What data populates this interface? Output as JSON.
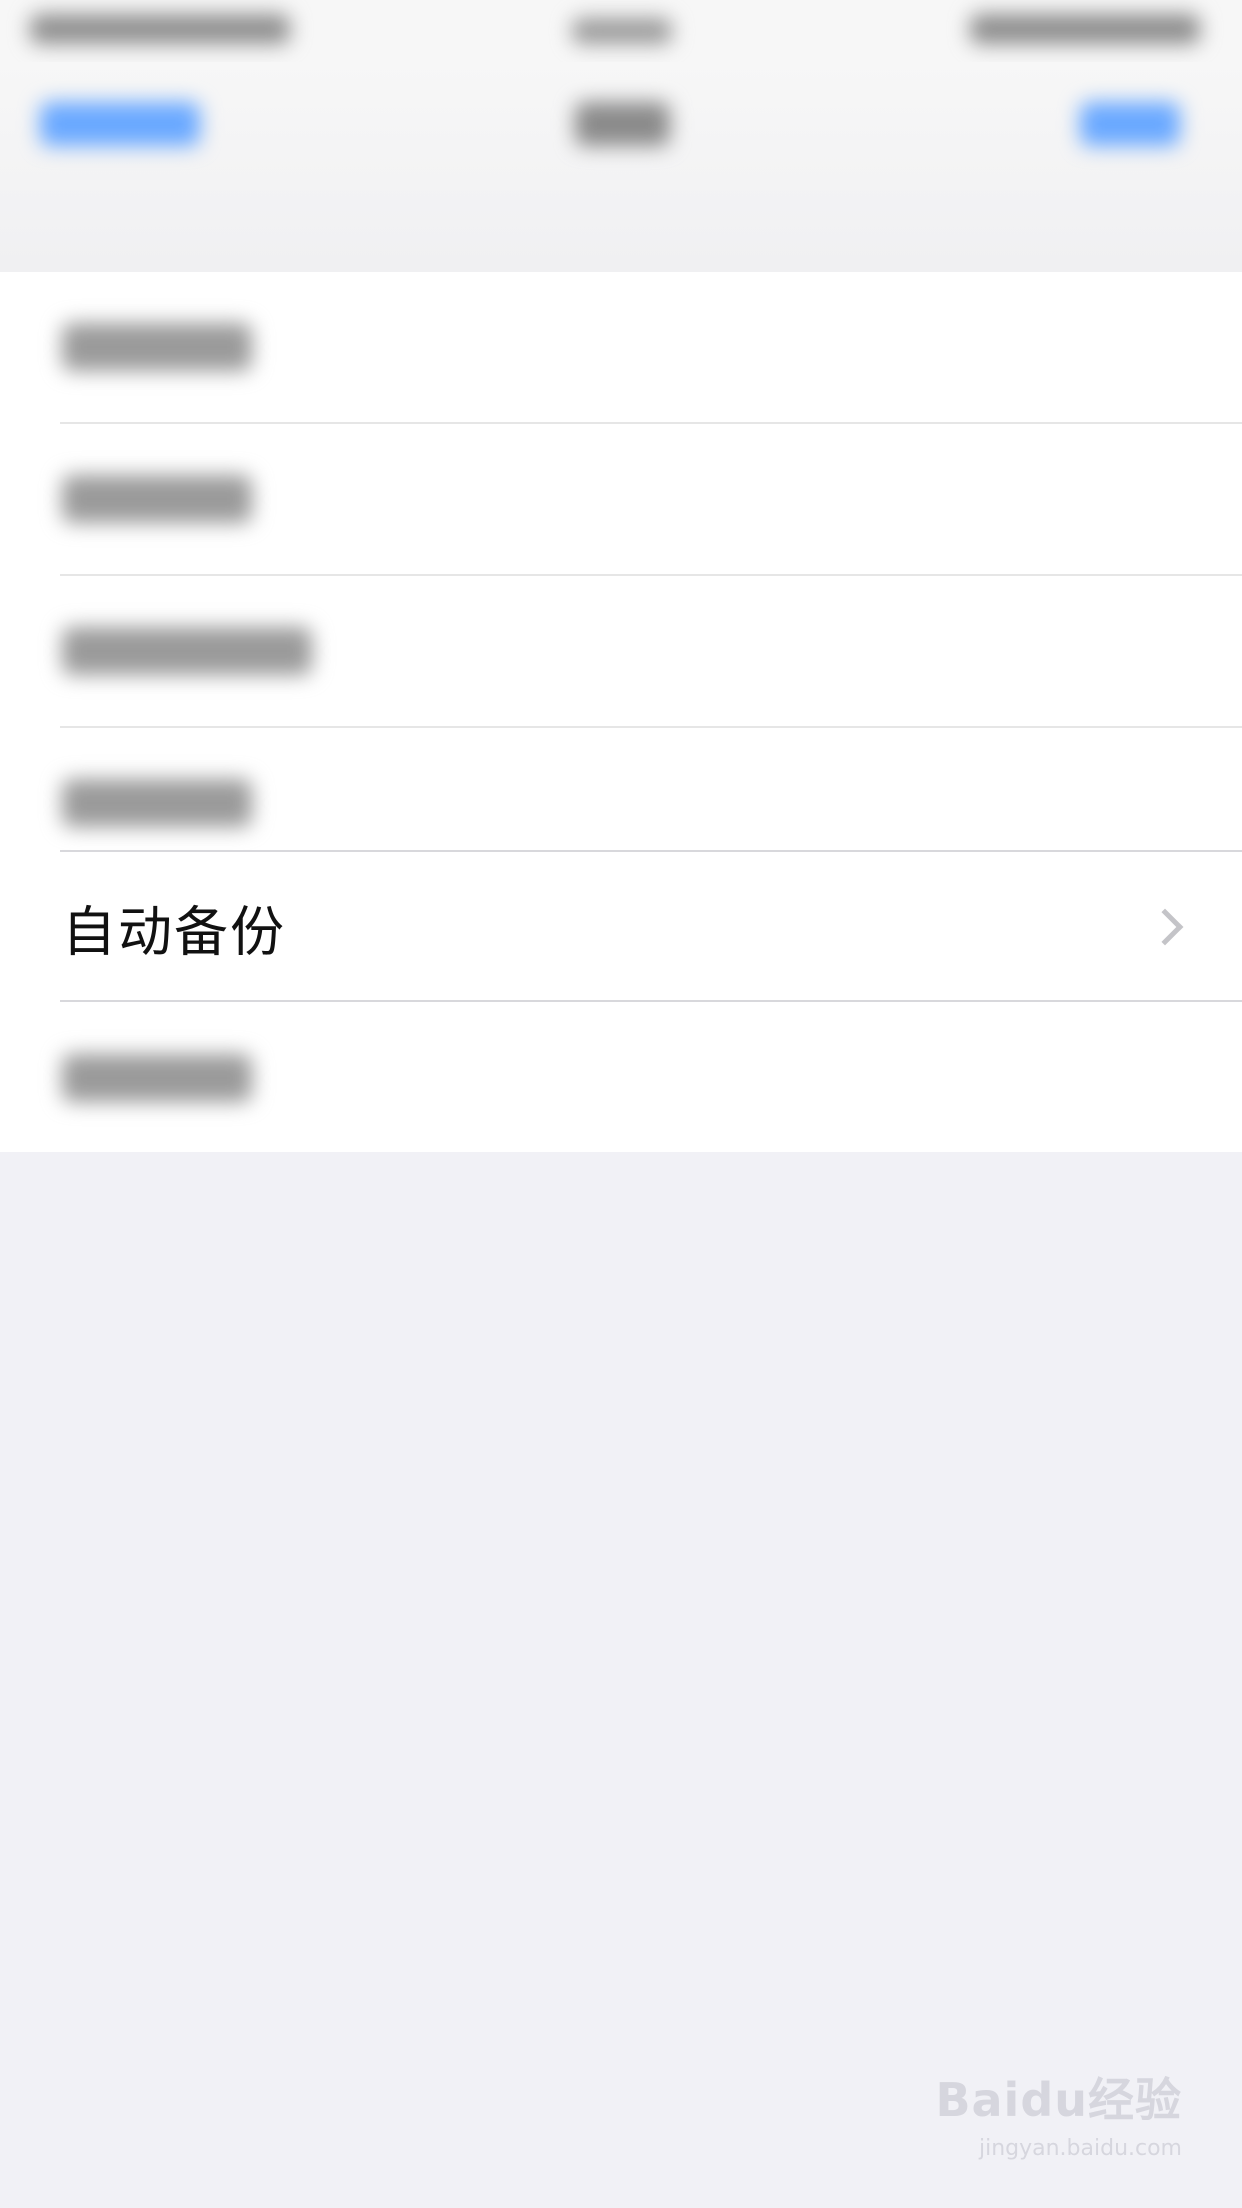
{
  "settings": {
    "rows": [
      {
        "label": "自动备份",
        "has_chevron": true
      }
    ]
  },
  "icons": {
    "chevron": "chevron-right-icon"
  },
  "watermark": {
    "brand": "Baidu经验",
    "site": "jingyan.baidu.com"
  }
}
